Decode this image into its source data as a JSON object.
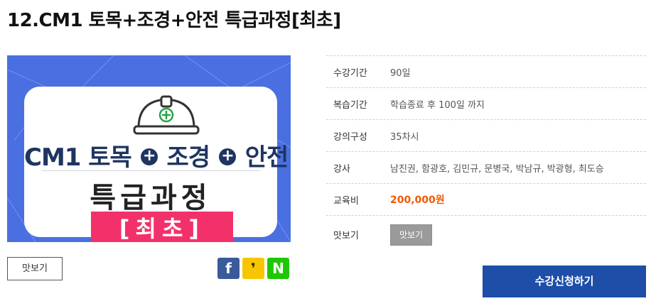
{
  "course": {
    "title": "12.CM1 토목+조경+안전 특급과정[최초]"
  },
  "thumbnail": {
    "line1_a": "CM1 토목",
    "plus": "+",
    "line1_b": "조경",
    "line1_c": "안전",
    "line2": "특급과정",
    "badge": "[최초]"
  },
  "left_actions": {
    "preview_label": "맛보기",
    "share": [
      {
        "name": "facebook",
        "glyph": "f",
        "color": "#3b5a9a"
      },
      {
        "name": "kakaostory",
        "glyph": "❜",
        "color": "#f7c600"
      },
      {
        "name": "naver",
        "glyph": "N",
        "color": "#1ec800"
      }
    ]
  },
  "info": [
    {
      "label": "수강기간",
      "value": "90일"
    },
    {
      "label": "복습기간",
      "value": "학습종료 후 100일 까지"
    },
    {
      "label": "강의구성",
      "value": "35차시"
    },
    {
      "label": "강사",
      "value": "남진권, 함광호, 김민규, 문병국, 박남규, 박광형, 최도승"
    },
    {
      "label": "교육비",
      "value": "200,000원"
    },
    {
      "label": "맛보기",
      "button": "맛보기"
    }
  ],
  "apply_label": "수강신청하기",
  "colors": {
    "accent": "#1e4ea8",
    "price": "#f25a00",
    "badge": "#f2316a",
    "thumb_bg": "#4a6fe0"
  }
}
